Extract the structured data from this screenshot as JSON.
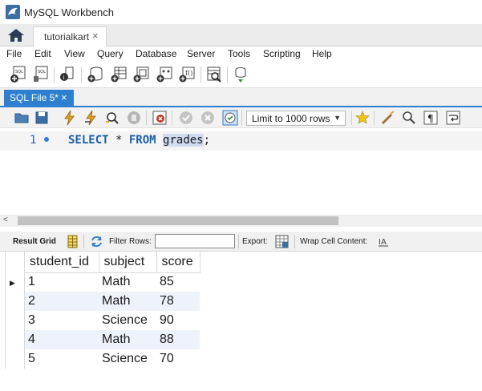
{
  "window": {
    "title": "MySQL Workbench",
    "icon": "dolphin-icon"
  },
  "connection_tab": {
    "label": "tutorialkart",
    "close": "×"
  },
  "menu": {
    "items": [
      "File",
      "Edit",
      "View",
      "Query",
      "Database",
      "Server",
      "Tools",
      "Scripting",
      "Help"
    ]
  },
  "sql_tab": {
    "label": "SQL File 5*",
    "close": "×"
  },
  "editor_toolbar": {
    "limit_value": "Limit to 1000 rows"
  },
  "editor": {
    "line_number": "1",
    "keyword_select": "SELECT",
    "star": " * ",
    "keyword_from": "FROM",
    "space": " ",
    "table_name": "grades",
    "terminator": ";"
  },
  "result_toolbar": {
    "result_grid": "Result Grid",
    "filter_rows": "Filter Rows:",
    "filter_value": "",
    "export": "Export:",
    "wrap_cell": "Wrap Cell Content:"
  },
  "grid": {
    "columns": [
      "student_id",
      "subject",
      "score"
    ],
    "rows": [
      [
        "1",
        "Math",
        "85"
      ],
      [
        "2",
        "Math",
        "78"
      ],
      [
        "3",
        "Science",
        "90"
      ],
      [
        "4",
        "Math",
        "88"
      ],
      [
        "5",
        "Science",
        "70"
      ]
    ]
  },
  "colors": {
    "accent": "#2f7fd0",
    "keyword": "#1b5fa8",
    "alt_row": "#eef3fb"
  }
}
